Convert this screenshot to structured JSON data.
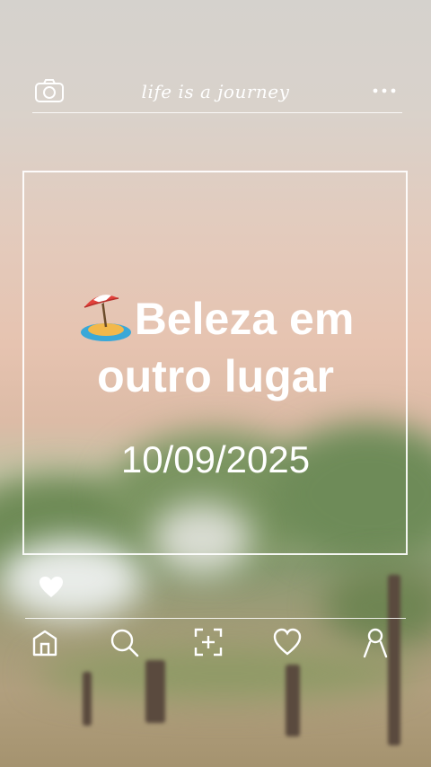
{
  "header": {
    "brand_text": "life is a journey",
    "camera_icon": "camera-icon",
    "more_icon": "more-dots-icon"
  },
  "post": {
    "title_emoji": "beach-umbrella-icon",
    "title_line1": "Beleza em",
    "title_line2": "outro lugar",
    "date": "10/09/2025",
    "like_icon": "heart-filled-icon"
  },
  "bottom_nav": {
    "items": [
      {
        "icon": "home-icon"
      },
      {
        "icon": "search-icon"
      },
      {
        "icon": "add-post-icon"
      },
      {
        "icon": "heart-outline-icon"
      },
      {
        "icon": "profile-icon"
      }
    ]
  },
  "colors": {
    "overlay_white": "#ffffff",
    "sky_top": "#d5d2cd",
    "sky_mid": "#e6c3b0",
    "foliage": "#8b9a72",
    "ground": "#a5936f"
  }
}
